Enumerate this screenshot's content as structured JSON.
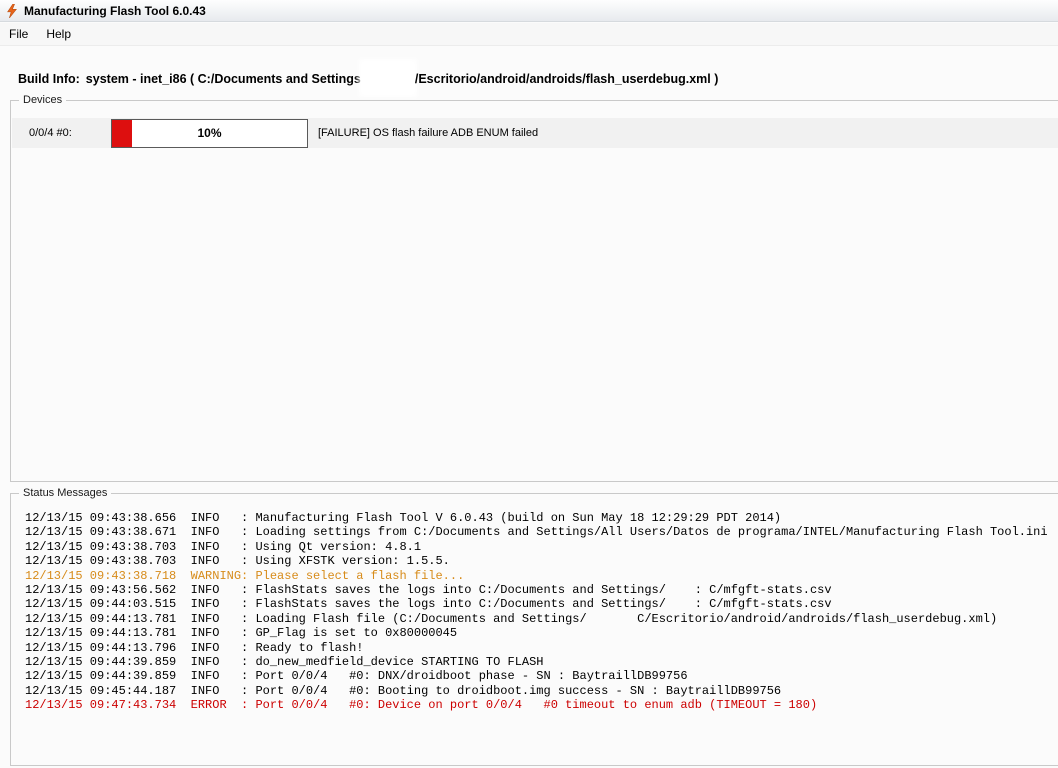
{
  "window": {
    "title": "Manufacturing Flash Tool 6.0.43",
    "icon": "lightning-bolt-icon"
  },
  "menu": {
    "file": "File",
    "help": "Help"
  },
  "build_info": {
    "label": "Build Info:",
    "value_before_redaction": "system - inet_i86 ( C:/Documents and Settings",
    "value_after_redaction": "/Escritorio/android/androids/flash_userdebug.xml )"
  },
  "devices": {
    "group_label": "Devices",
    "device_row": {
      "port_label": "0/0/4  #0:",
      "progress_percent": 10,
      "progress_label": "10%",
      "status_text": "[FAILURE] OS flash failure ADB ENUM failed"
    }
  },
  "status_messages": {
    "group_label": "Status Messages",
    "logs": [
      {
        "time": "12/13/15 09:43:38.656",
        "level": "INFO",
        "severity": "info",
        "message": "Manufacturing Flash Tool V 6.0.43 (build on Sun May 18 12:29:29 PDT 2014)"
      },
      {
        "time": "12/13/15 09:43:38.671",
        "level": "INFO",
        "severity": "info",
        "message": "Loading settings from C:/Documents and Settings/All Users/Datos de programa/INTEL/Manufacturing Flash Tool.ini"
      },
      {
        "time": "12/13/15 09:43:38.703",
        "level": "INFO",
        "severity": "info",
        "message": "Using Qt version: 4.8.1"
      },
      {
        "time": "12/13/15 09:43:38.703",
        "level": "INFO",
        "severity": "info",
        "message": "Using XFSTK version: 1.5.5."
      },
      {
        "time": "12/13/15 09:43:38.718",
        "level": "WARNING",
        "severity": "warning",
        "message": "Please select a flash file..."
      },
      {
        "time": "12/13/15 09:43:56.562",
        "level": "INFO",
        "severity": "info",
        "message": "FlashStats saves the logs into C:/Documents and Settings/    : C/mfgft-stats.csv"
      },
      {
        "time": "12/13/15 09:44:03.515",
        "level": "INFO",
        "severity": "info",
        "message": "FlashStats saves the logs into C:/Documents and Settings/    : C/mfgft-stats.csv"
      },
      {
        "time": "12/13/15 09:44:13.781",
        "level": "INFO",
        "severity": "info",
        "message": "Loading Flash file (C:/Documents and Settings/       C/Escritorio/android/androids/flash_userdebug.xml)"
      },
      {
        "time": "12/13/15 09:44:13.781",
        "level": "INFO",
        "severity": "info",
        "message": "GP_Flag is set to 0x80000045"
      },
      {
        "time": "12/13/15 09:44:13.796",
        "level": "INFO",
        "severity": "info",
        "message": "Ready to flash!"
      },
      {
        "time": "12/13/15 09:44:39.859",
        "level": "INFO",
        "severity": "info",
        "message": "do_new_medfield_device STARTING TO FLASH"
      },
      {
        "time": "12/13/15 09:44:39.859",
        "level": "INFO",
        "severity": "info",
        "message": "Port 0/0/4   #0: DNX/droidboot phase - SN : BaytraillDB99756"
      },
      {
        "time": "12/13/15 09:45:44.187",
        "level": "INFO",
        "severity": "info",
        "message": "Port 0/0/4   #0: Booting to droidboot.img success - SN : BaytraillDB99756"
      },
      {
        "time": "12/13/15 09:47:43.734",
        "level": "ERROR",
        "severity": "error",
        "message": "Port 0/0/4   #0: Device on port 0/0/4   #0 timeout to enum adb (TIMEOUT = 180)"
      }
    ]
  },
  "colors": {
    "progress_fill": "#dd0f0f",
    "warning_text": "#d78b1a",
    "error_text": "#cc0000"
  }
}
